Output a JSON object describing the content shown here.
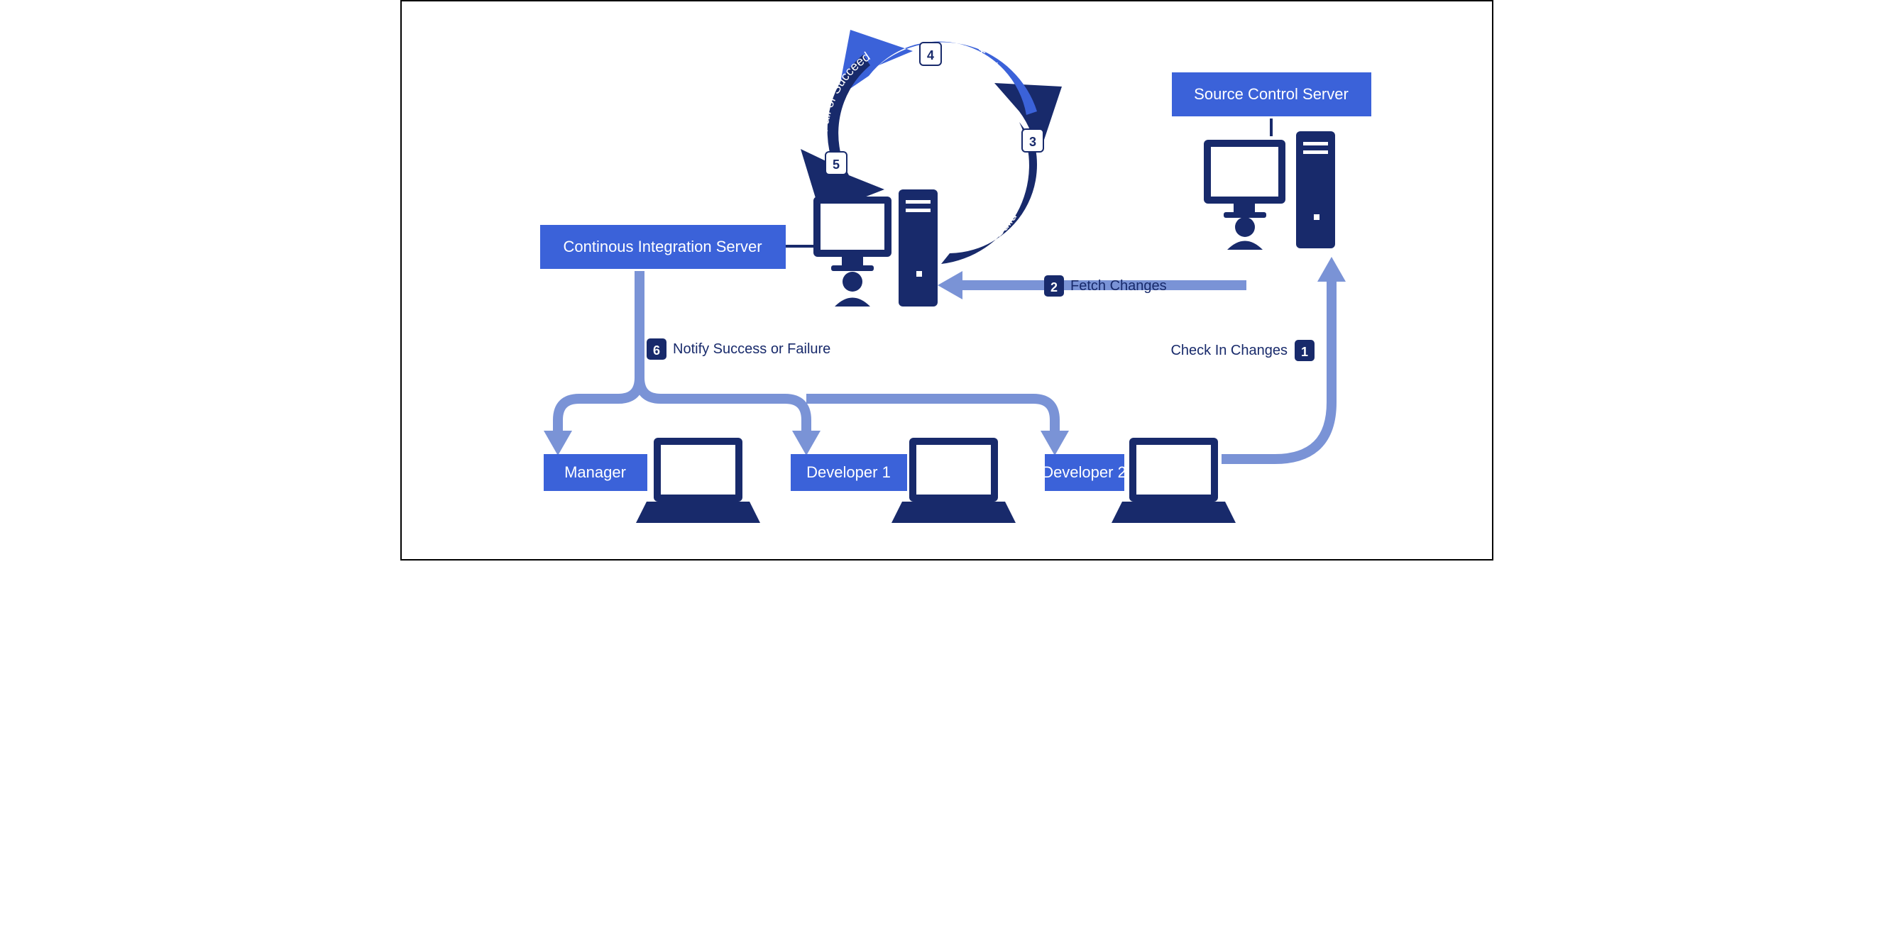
{
  "boxes": {
    "ci_server": "Continous Integration Server",
    "source_control": "Source Control Server",
    "manager": "Manager",
    "dev1": "Developer 1",
    "dev2": "Developer 2"
  },
  "cycle": {
    "build": {
      "num": "3",
      "label": "Build"
    },
    "test": {
      "num": "4",
      "label": "Test"
    },
    "result": {
      "num": "5",
      "label": "Fail or Succeed"
    }
  },
  "flows": {
    "checkin": {
      "num": "1",
      "label": "Check In Changes"
    },
    "fetch": {
      "num": "2",
      "label": "Fetch Changes"
    },
    "notify": {
      "num": "6",
      "label": "Notify Success or Failure"
    }
  },
  "colors": {
    "box": "#3b62d9",
    "dark": "#182a6b",
    "light": "#3b62d9",
    "mid": "#7a93d6"
  }
}
